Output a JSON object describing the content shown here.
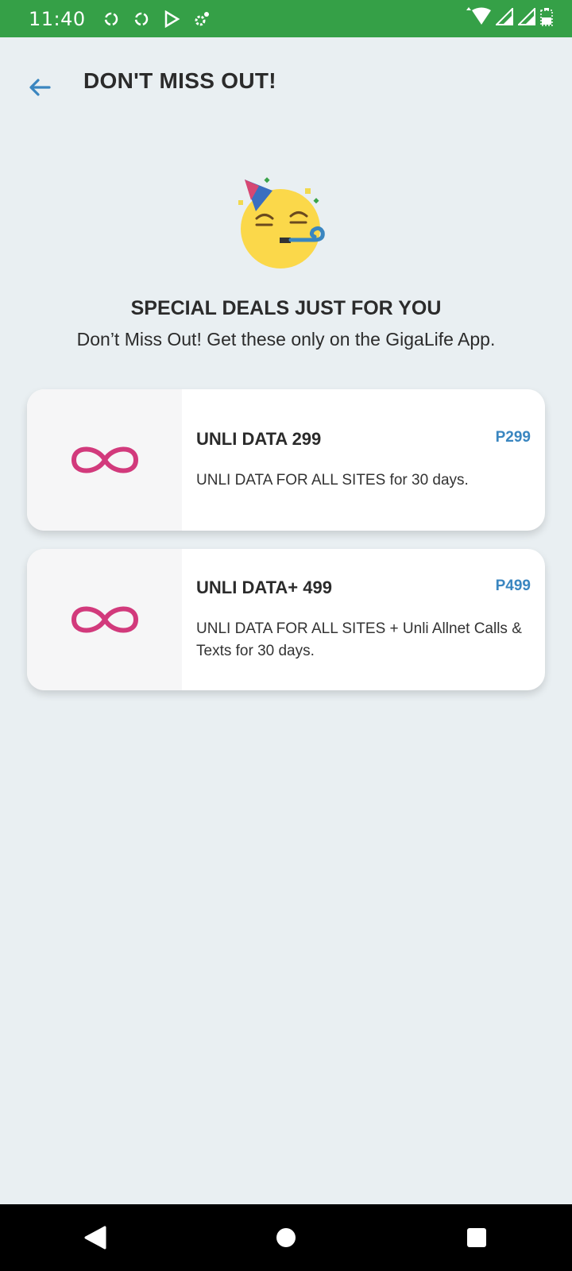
{
  "status_bar": {
    "time": "11:40",
    "left_icons": [
      "sync-icon",
      "sync-icon",
      "play-store-icon",
      "settings-icon"
    ],
    "right_icons": [
      "wifi-icon",
      "signal-icon",
      "signal-icon",
      "battery-icon"
    ]
  },
  "header": {
    "title": "DON'T MISS OUT!",
    "back_icon": "arrow-left-icon",
    "accent_color": "#3a86c0"
  },
  "hero": {
    "icon": "party-face-icon",
    "title": "SPECIAL DEALS JUST FOR YOU",
    "subtitle": "Don’t Miss Out! Get these only on the GigaLife App."
  },
  "offers": [
    {
      "icon": "infinity-icon",
      "name": "UNLI DATA 299",
      "price": "P299",
      "description": "UNLI DATA FOR ALL SITES for 30 days."
    },
    {
      "icon": "infinity-icon",
      "name": "UNLI DATA+ 499",
      "price": "P499",
      "description": "UNLI DATA FOR ALL SITES + Unli Allnet Calls & Texts for 30 days."
    }
  ],
  "colors": {
    "status_bar": "#35a047",
    "background": "#e9eff2",
    "infinity": "#d23a7c",
    "price": "#3a86c0"
  },
  "nav_bar": {
    "buttons": [
      "back-triangle-icon",
      "home-circle-icon",
      "recents-square-icon"
    ]
  }
}
